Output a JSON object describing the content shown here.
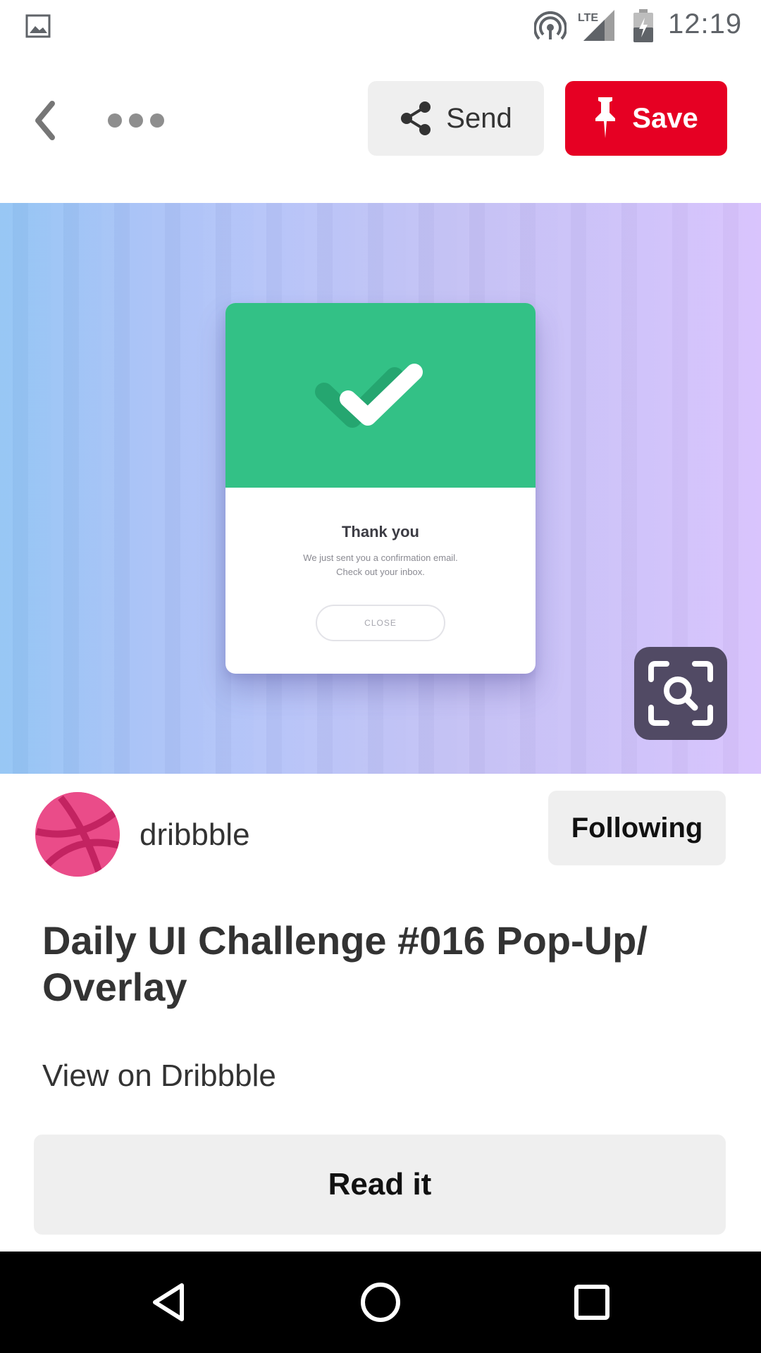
{
  "status_bar": {
    "time": "12:19",
    "network_label": "LTE",
    "icons": [
      "gallery-icon",
      "hotspot-icon",
      "signal-icon",
      "battery-charging-icon"
    ]
  },
  "toolbar": {
    "back_icon": "chevron-left-icon",
    "more_icon": "more-horizontal-icon",
    "send_label": "Send",
    "send_icon": "share-icon",
    "save_label": "Save",
    "save_icon": "pin-icon"
  },
  "hero_image": {
    "card_title": "Thank you",
    "card_message_line1": "We just sent you a confirmation email.",
    "card_message_line2": "Check out your inbox.",
    "card_button": "CLOSE",
    "lens_icon": "visual-search-icon"
  },
  "author": {
    "name": "dribbble",
    "follow_label": "Following"
  },
  "pin": {
    "title": "Daily UI Challenge #016 Pop-Up/ Overlay",
    "link_label": "View on Dribbble",
    "read_label": "Read it"
  },
  "nav_bar": {
    "icons": [
      "back-triangle-icon",
      "home-circle-icon",
      "recents-square-icon"
    ]
  },
  "colors": {
    "save_red": "#e60023",
    "card_green": "#33c186",
    "button_gray": "#efefef",
    "dribbble_pink": "#ea4c89",
    "lens_bg": "#514a64"
  }
}
